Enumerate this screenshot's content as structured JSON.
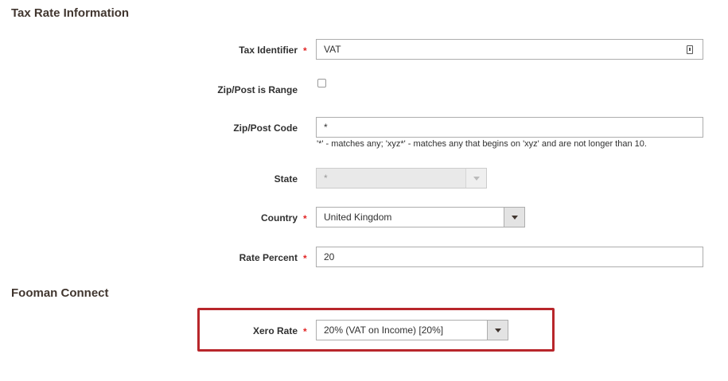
{
  "sections": {
    "tax_rate_info": "Tax Rate Information",
    "fooman_connect": "Fooman Connect"
  },
  "fields": {
    "tax_identifier": {
      "label": "Tax Identifier",
      "value": "VAT",
      "required": true
    },
    "zip_range": {
      "label": "Zip/Post is Range",
      "checked": false
    },
    "zip_code": {
      "label": "Zip/Post Code",
      "value": "*",
      "note": "'*' - matches any; 'xyz*' - matches any that begins on 'xyz' and are not longer than 10."
    },
    "state": {
      "label": "State",
      "value": "*",
      "disabled": true
    },
    "country": {
      "label": "Country",
      "value": "United Kingdom",
      "required": true
    },
    "rate_percent": {
      "label": "Rate Percent",
      "value": "20",
      "required": true
    },
    "xero_rate": {
      "label": "Xero Rate",
      "value": "20% (VAT on Income) [20%]",
      "required": true
    }
  },
  "required_marker": "*",
  "colors": {
    "required": "#e22626",
    "highlight_border": "#b8262b",
    "section_title": "#41362f"
  }
}
